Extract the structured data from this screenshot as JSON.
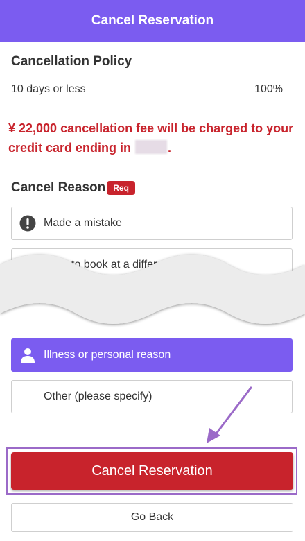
{
  "header": {
    "title": "Cancel Reservation"
  },
  "policy": {
    "title": "Cancellation Policy",
    "condition": "10 days or less",
    "rate": "100%"
  },
  "warning": {
    "line1": "¥ 22,000 cancellation fee will be charged to your",
    "line2_prefix": "credit card ending in",
    "line2_suffix": "."
  },
  "reason": {
    "title": "Cancel Reason",
    "badge": "Req",
    "options": [
      {
        "label": "Made a mistake",
        "icon": "exclamation-icon",
        "selected": false
      },
      {
        "label": "Wish to book at a different location",
        "icon": "store-icon",
        "selected": false
      },
      {
        "label": "Illness or personal reason",
        "icon": "person-icon",
        "selected": true
      },
      {
        "label": "Other (please specify)",
        "icon": "",
        "selected": false
      }
    ]
  },
  "actions": {
    "cancel_label": "Cancel Reservation",
    "back_label": "Go Back"
  },
  "colors": {
    "header": "#7b5cf0",
    "selected": "#7b5cf0",
    "danger": "#c8232c",
    "annotation": "#9b6ac8"
  }
}
